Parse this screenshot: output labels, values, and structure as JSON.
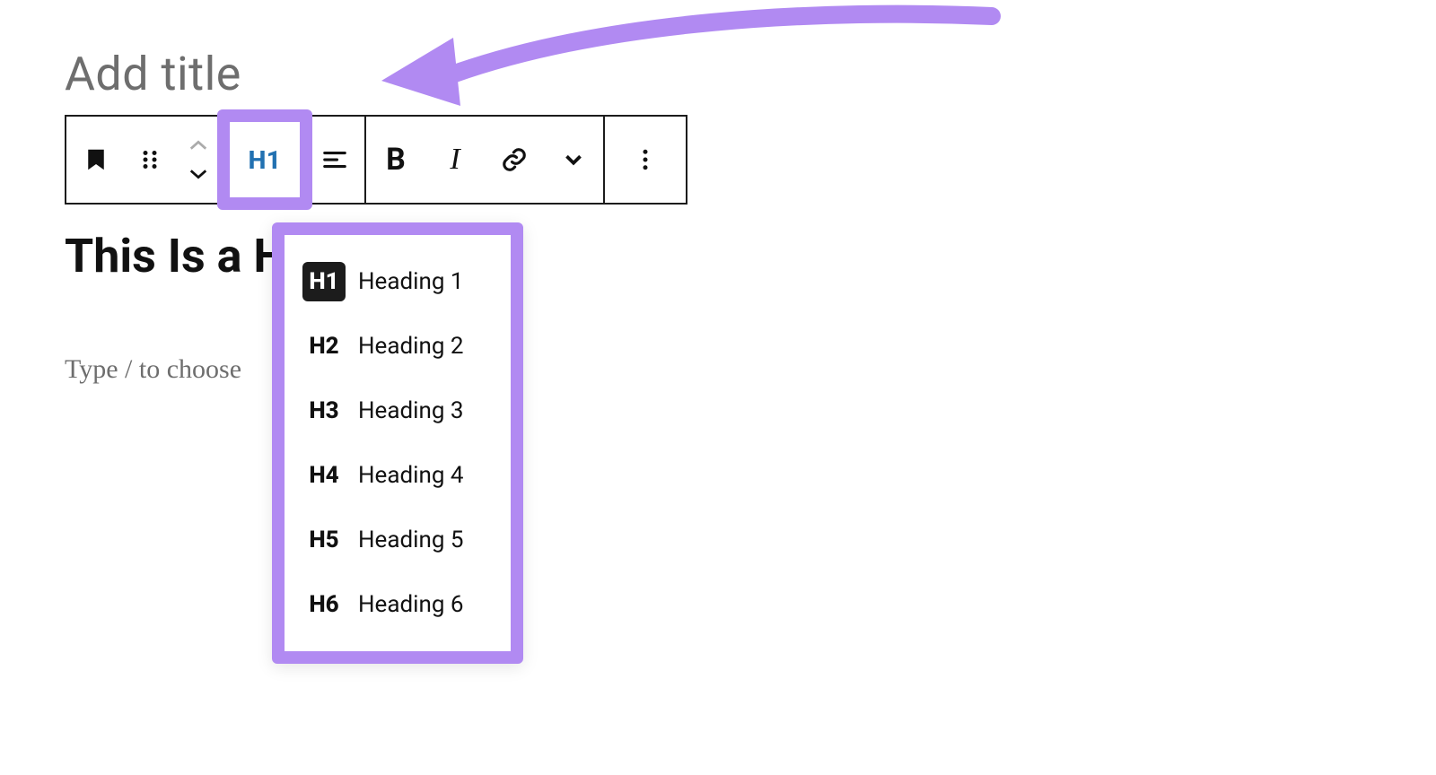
{
  "title_placeholder": "Add title",
  "heading_content_text": "This Is a H",
  "paragraph_placeholder": "Type / to choose",
  "toolbar": {
    "heading_level_button_label": "H1"
  },
  "heading_dropdown": {
    "items": [
      {
        "tag": "H1",
        "label": "Heading 1",
        "selected": true
      },
      {
        "tag": "H2",
        "label": "Heading 2",
        "selected": false
      },
      {
        "tag": "H3",
        "label": "Heading 3",
        "selected": false
      },
      {
        "tag": "H4",
        "label": "Heading 4",
        "selected": false
      },
      {
        "tag": "H5",
        "label": "Heading 5",
        "selected": false
      },
      {
        "tag": "H6",
        "label": "Heading 6",
        "selected": false
      }
    ]
  },
  "annotation": {
    "highlight_color": "#b18af2"
  }
}
